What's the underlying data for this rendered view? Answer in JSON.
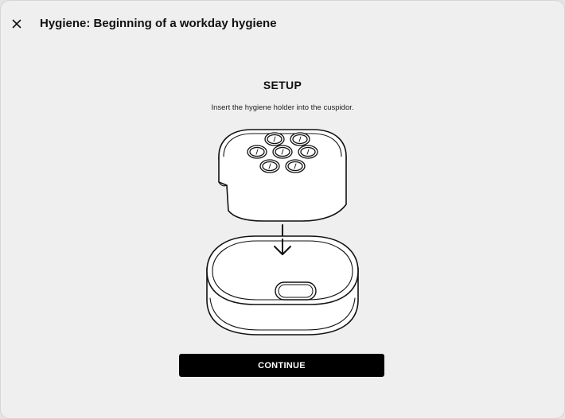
{
  "header": {
    "title": "Hygiene: Beginning of a workday hygiene",
    "close_icon": "close-icon"
  },
  "main": {
    "heading": "SETUP",
    "instruction": "Insert the hygiene holder into the cuspidor.",
    "illustration_icon": "hygiene-holder-into-cuspidor-illustration",
    "continue_label": "CONTINUE"
  },
  "colors": {
    "background": "#efefef",
    "text": "#111111",
    "button_background": "#000000",
    "button_text": "#ffffff"
  }
}
